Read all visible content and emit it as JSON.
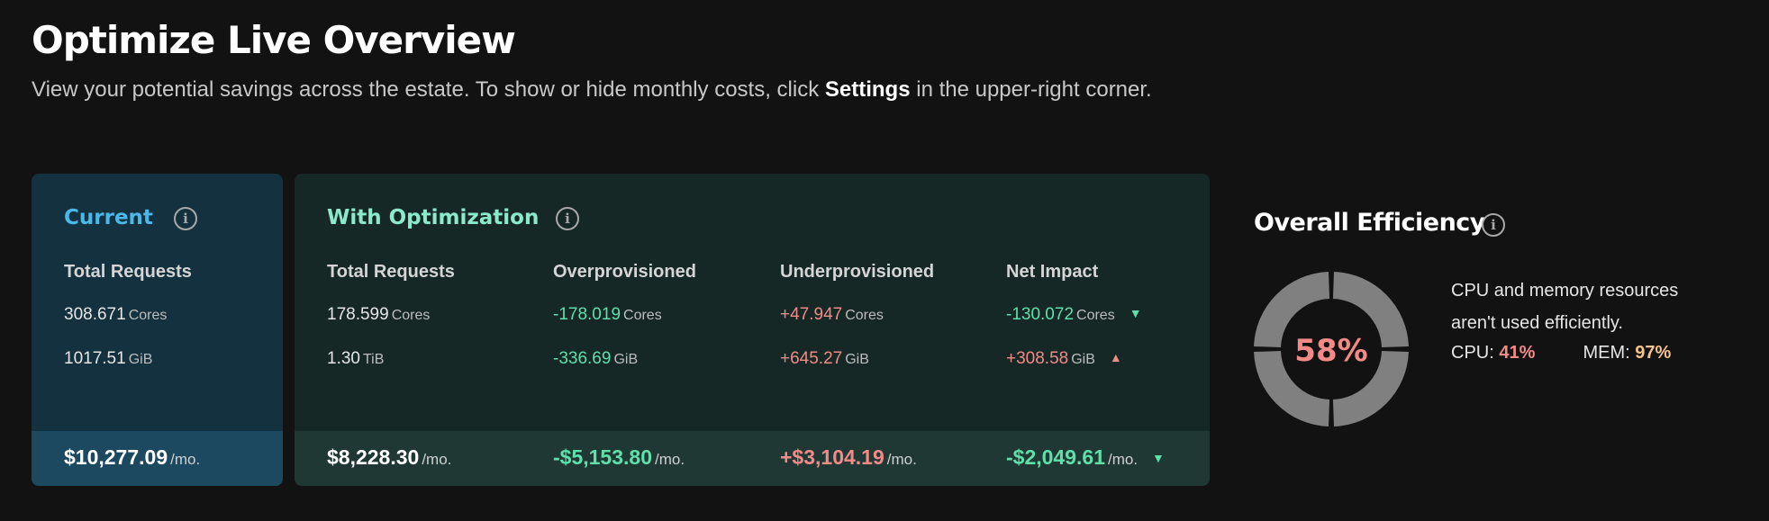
{
  "header": {
    "title": "Optimize Live Overview",
    "subtitle_before": "View your potential savings across the estate. To show or hide monthly costs, click ",
    "subtitle_bold": "Settings",
    "subtitle_after": " in the upper-right corner."
  },
  "current": {
    "title": "Current",
    "column": "Total Requests",
    "cpu": {
      "value": "308.671",
      "unit": "Cores"
    },
    "memory": {
      "value": "1017.51",
      "unit": "GiB"
    },
    "cost": {
      "value": "$10,277.09",
      "unit": "/mo."
    }
  },
  "optimization": {
    "title": "With Optimization",
    "columns": [
      {
        "header": "Total Requests",
        "cpu": "178.599",
        "cpu_unit": "Cores",
        "mem": "1.30",
        "mem_unit": "TiB",
        "cost": "$8,228.30",
        "cost_unit": "/mo."
      },
      {
        "header": "Overprovisioned",
        "cpu": "-178.019",
        "cpu_unit": "Cores",
        "mem": "-336.69",
        "mem_unit": "GiB",
        "cost": "-$5,153.80",
        "cost_unit": "/mo."
      },
      {
        "header": "Underprovisioned",
        "cpu": "+47.947",
        "cpu_unit": "Cores",
        "mem": "+645.27",
        "mem_unit": "GiB",
        "cost": "+$3,104.19",
        "cost_unit": "/mo."
      },
      {
        "header": "Net Impact",
        "cpu": "-130.072",
        "cpu_unit": "Cores",
        "mem": "+308.58",
        "mem_unit": "GiB",
        "cost": "-$2,049.61",
        "cost_unit": "/mo."
      }
    ]
  },
  "efficiency": {
    "title": "Overall Efficiency",
    "percent": "58%",
    "percent_value": 58,
    "description_line1": "CPU and memory resources",
    "description_line2": "aren't used efficiently.",
    "cpu_label": "CPU:",
    "cpu_value": "41%",
    "mem_label": "MEM:",
    "mem_value": "97%"
  },
  "colors": {
    "green": "#5fe0ab",
    "red": "#f28a87",
    "current_accent": "#4ab8e8",
    "optimization_accent": "#8ce9c9",
    "gauge_fill": "#f28a87",
    "gauge_track": "#808080"
  },
  "icons": {
    "info": "info-icon",
    "arrow_down": "triangle-down-icon",
    "arrow_up": "triangle-up-icon"
  }
}
